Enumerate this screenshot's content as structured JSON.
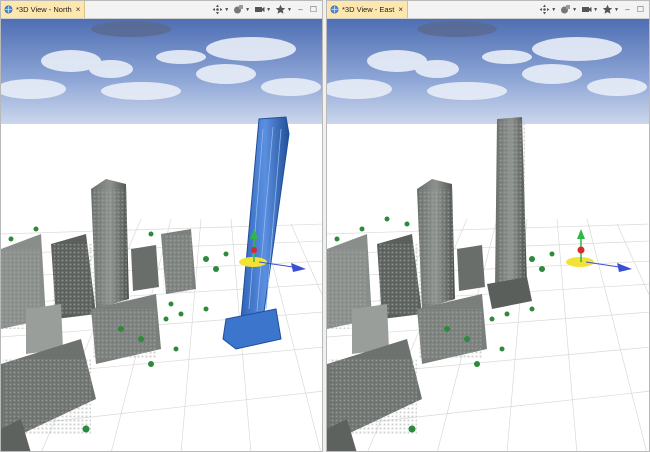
{
  "views": [
    {
      "id": "north",
      "tab_label": "*3D View - North",
      "close_glyph": "×",
      "selected_building": "highlighted-blue"
    },
    {
      "id": "east",
      "tab_label": "*3D View - East",
      "close_glyph": "×",
      "selected_building": "none"
    }
  ],
  "window_buttons": {
    "minimize": "–",
    "maximize": "☐"
  },
  "toolbar_icons": [
    "navigate-icon",
    "layers-icon",
    "camera-icon",
    "bookmark-star-icon"
  ],
  "colors": {
    "tab_active": "#fde7ae",
    "selection_blue": "#3f7fd6",
    "gizmo_yellow": "#f2e236",
    "gizmo_green": "#2fb84a",
    "gizmo_red": "#d92a2a",
    "gizmo_blue": "#3b4fd6",
    "grid_line": "#d9d9d9"
  }
}
